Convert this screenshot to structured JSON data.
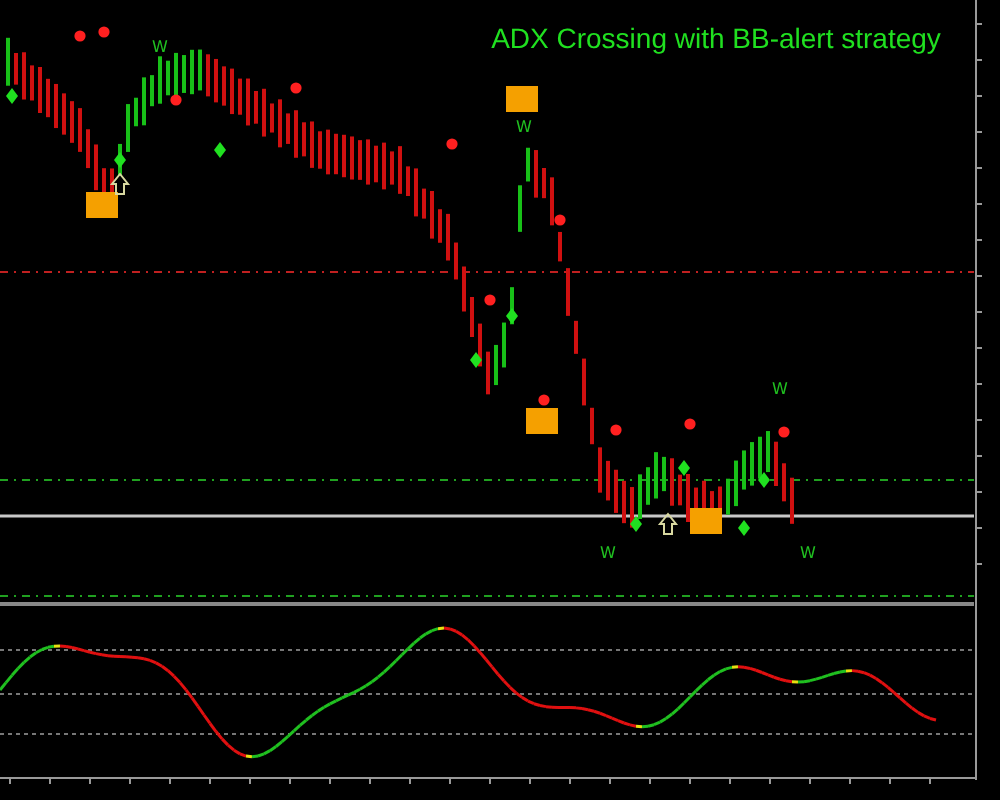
{
  "chart": {
    "title": "ADX Crossing with BB-alert strategy",
    "signal_labels": [
      "W",
      "W",
      "W",
      "W",
      "W"
    ]
  }
}
